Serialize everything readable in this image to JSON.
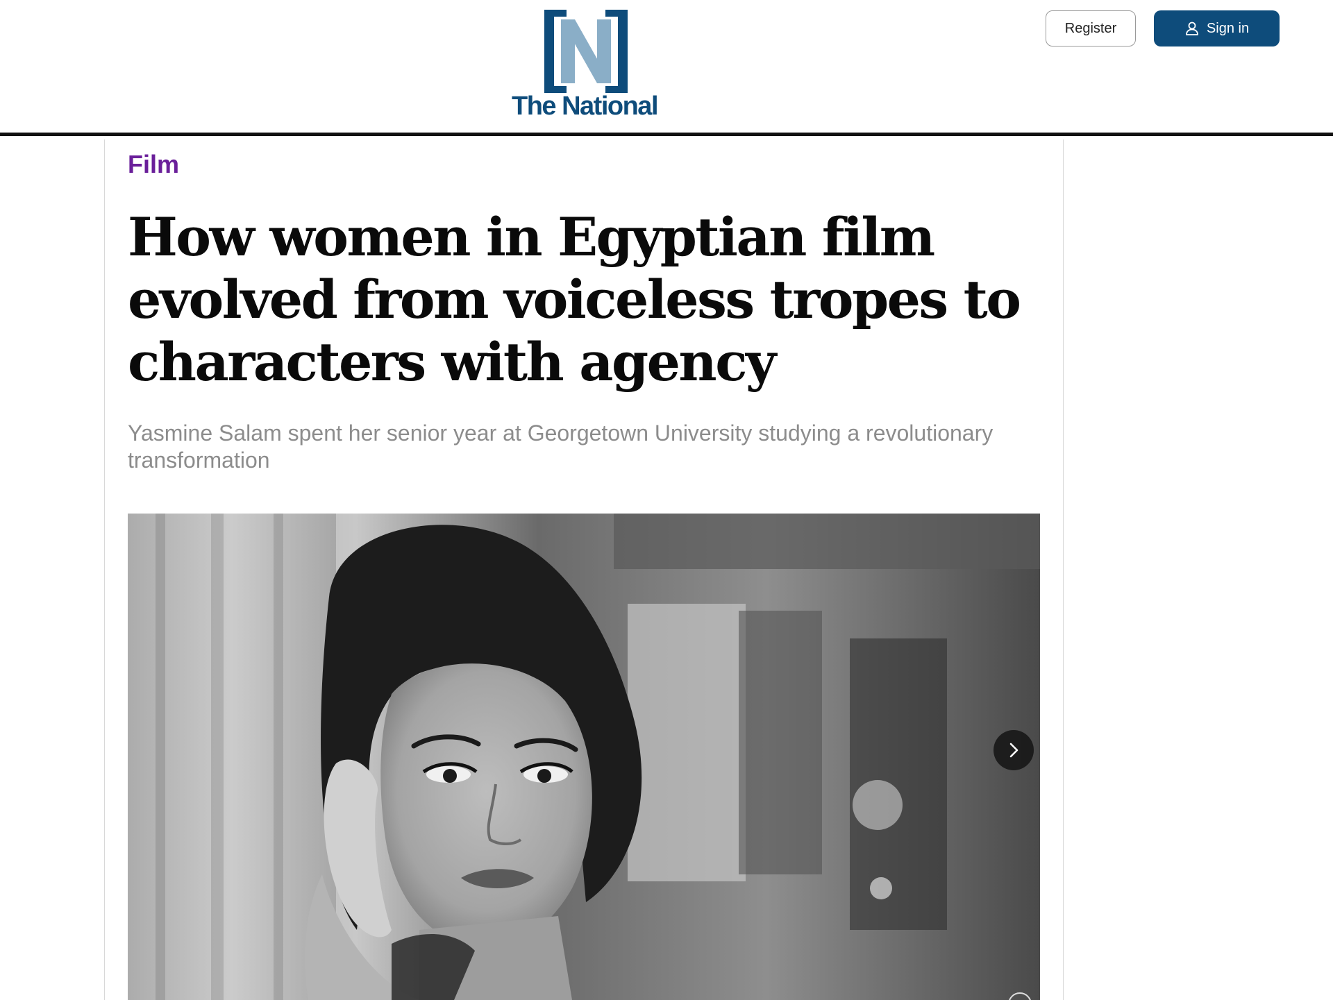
{
  "header": {
    "logo_text": "The National",
    "register_label": "Register",
    "signin_label": "Sign in",
    "brand_color": "#0e4c7b",
    "logo_accent_color": "#8aaec7"
  },
  "article": {
    "kicker": "Film",
    "kicker_color": "#6a1f9a",
    "headline": "How women in Egyptian film evolved from voiceless tropes to characters with agency",
    "standfirst": "Yasmine Salam spent her senior year at Georgetown University studying a revolutionary transformation"
  },
  "carousel": {
    "next_icon": "chevron-right-icon",
    "image_description_icon": "photo"
  }
}
